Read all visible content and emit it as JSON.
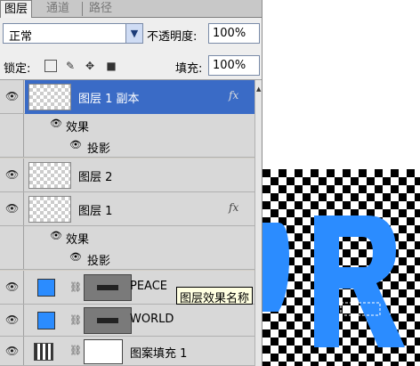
{
  "tabs": [
    "图层",
    "通道",
    "路径"
  ],
  "blend_mode": "正常",
  "opacity_label": "不透明度:",
  "opacity_value": "100%",
  "lock_label": "锁定:",
  "fill_label": "填充:",
  "fill_value": "100%",
  "layers": [
    {
      "name": "图层 1 副本",
      "fx": "fx",
      "selected": true
    },
    {
      "effects_label": "效果",
      "effect": "投影"
    },
    {
      "name": "图层 2"
    },
    {
      "name": "图层 1",
      "fx": "fx"
    },
    {
      "effects_label": "效果",
      "effect": "投影"
    },
    {
      "name": "PEACE"
    },
    {
      "name": "WORLD"
    },
    {
      "name": "图案填充 1"
    }
  ],
  "tooltip": "图层效果名称",
  "colors": {
    "selected": "#3a6bc6",
    "shape_blue": "#2b8cff"
  }
}
